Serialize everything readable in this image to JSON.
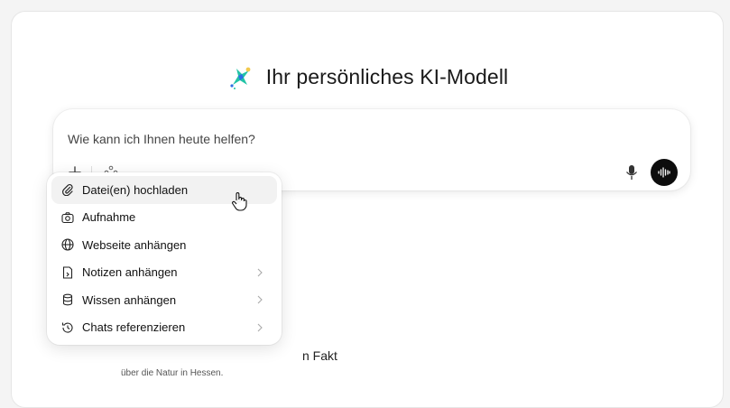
{
  "header": {
    "title": "Ihr persönliches KI-Modell",
    "colors": {
      "logo_teal": "#22c3a6",
      "logo_blue": "#2f6fe4",
      "logo_yellow": "#f2c94c"
    }
  },
  "composer": {
    "placeholder": "Wie kann ich Ihnen heute helfen?",
    "voice_button_bg": "#0d0d0d"
  },
  "menu": {
    "items": [
      {
        "label": "Datei(en) hochladen",
        "icon": "paperclip-icon",
        "submenu": false,
        "active": true
      },
      {
        "label": "Aufnahme",
        "icon": "camera-icon",
        "submenu": false,
        "active": false
      },
      {
        "label": "Webseite anhängen",
        "icon": "globe-icon",
        "submenu": false,
        "active": false
      },
      {
        "label": "Notizen anhängen",
        "icon": "note-icon",
        "submenu": true,
        "active": false
      },
      {
        "label": "Wissen anhängen",
        "icon": "database-icon",
        "submenu": true,
        "active": false
      },
      {
        "label": "Chats referenzieren",
        "icon": "history-icon",
        "submenu": true,
        "active": false
      }
    ]
  },
  "suggestion": {
    "title_fragment": "n Fakt",
    "subtitle": "über die Natur in Hessen."
  }
}
